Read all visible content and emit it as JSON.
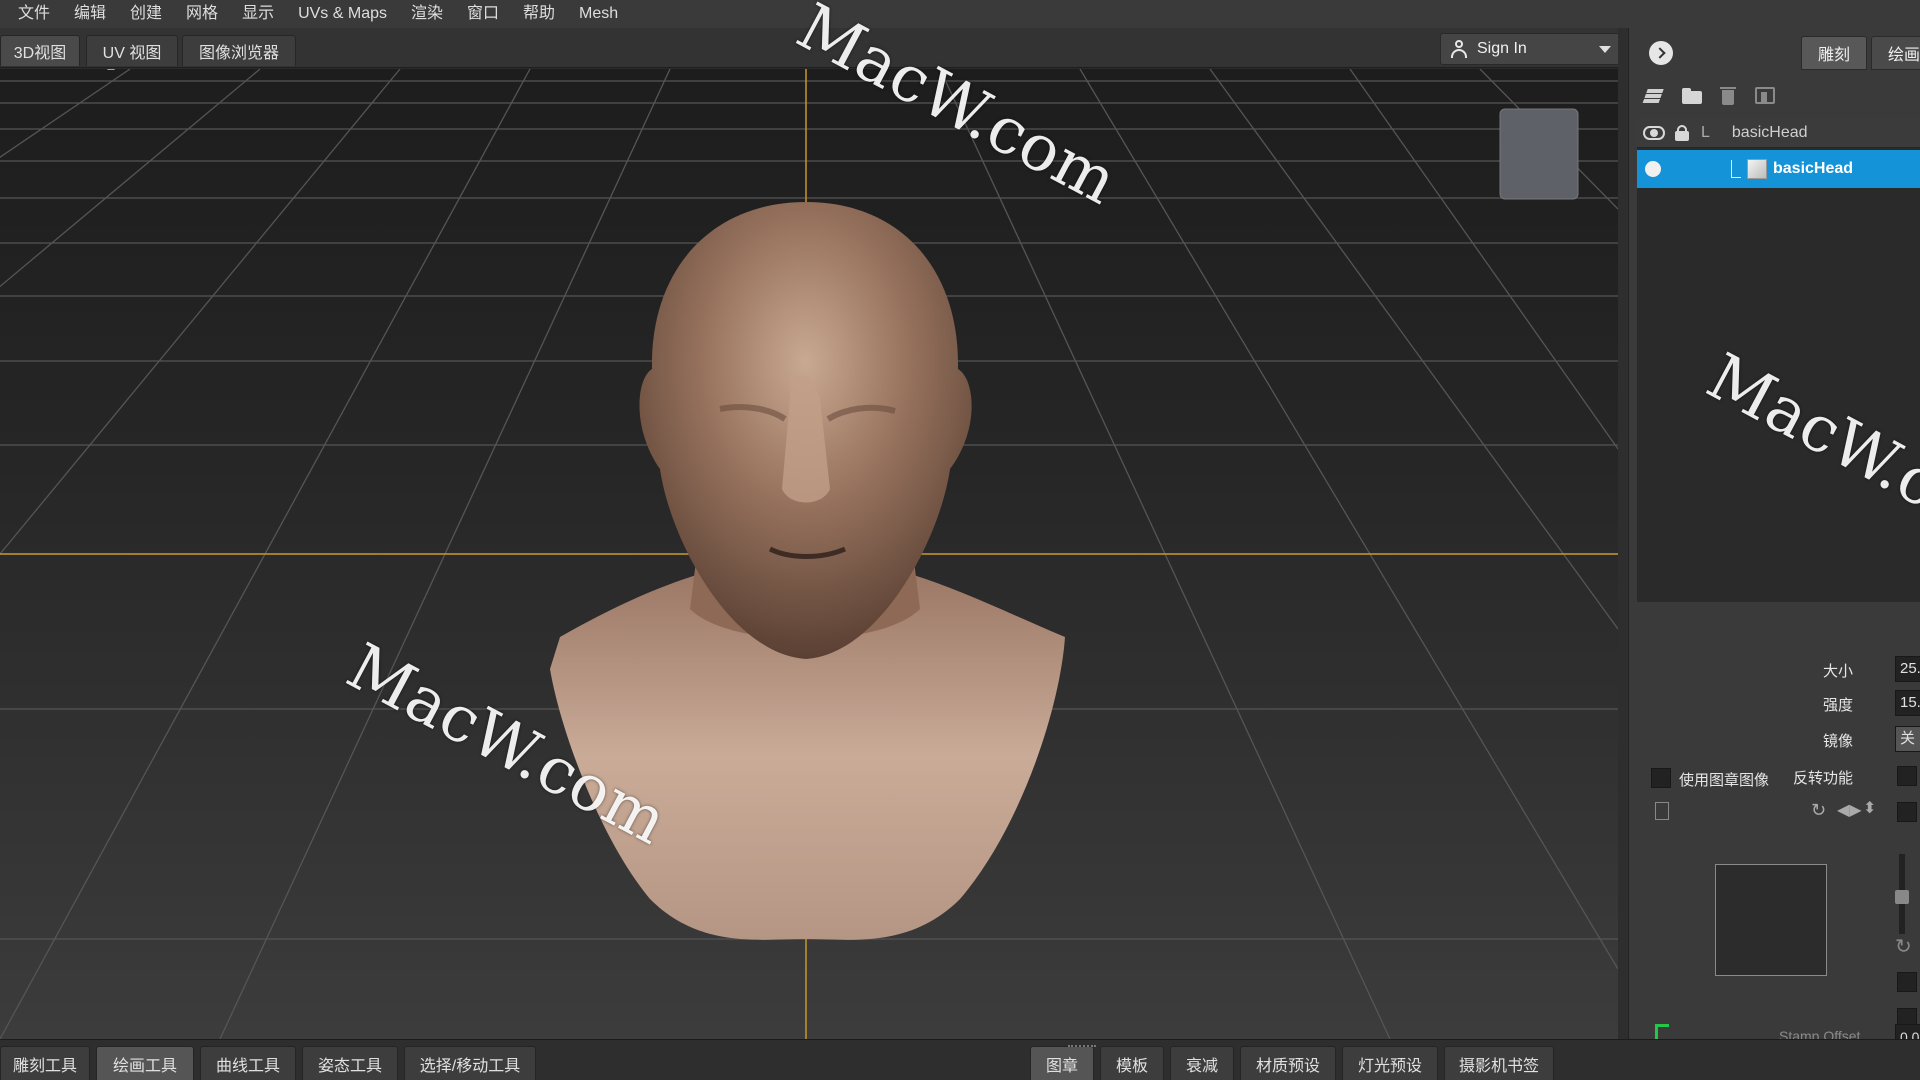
{
  "menu": [
    "文件",
    "编辑",
    "创建",
    "网格",
    "显示",
    "UVs & Maps",
    "渲染",
    "窗口",
    "帮助",
    "Mesh"
  ],
  "view_tabs": [
    "3D视图",
    "UV 视图",
    "图像浏览器"
  ],
  "signin": {
    "label": "Sign In"
  },
  "right_tabs": [
    "雕刻",
    "绘画"
  ],
  "layers": {
    "parent": {
      "flag": "L",
      "name": "basicHead"
    },
    "child": {
      "name": "basicHead"
    }
  },
  "properties": {
    "size": {
      "label": "大小",
      "value": "25."
    },
    "strength": {
      "label": "强度",
      "value": "15."
    },
    "mirror": {
      "label": "镜像",
      "value": "关"
    },
    "invert": {
      "label": "反转功能"
    }
  },
  "stamp": {
    "use_label": "使用图章图像",
    "offset_label": "Stamp Offset",
    "offset_value": "0.0"
  },
  "tool_tabs": [
    "雕刻工具",
    "绘画工具",
    "曲线工具",
    "姿态工具",
    "选择/移动工具"
  ],
  "library_tabs": [
    "图章",
    "模板",
    "衰减",
    "材质预设",
    "灯光预设",
    "摄影机书签"
  ],
  "watermarks": [
    "MacW.com",
    "MacW.com",
    "MacW.com"
  ],
  "colors": {
    "selected": "#1493d8",
    "axis": "#c8962a",
    "skin": "#9a7560"
  }
}
